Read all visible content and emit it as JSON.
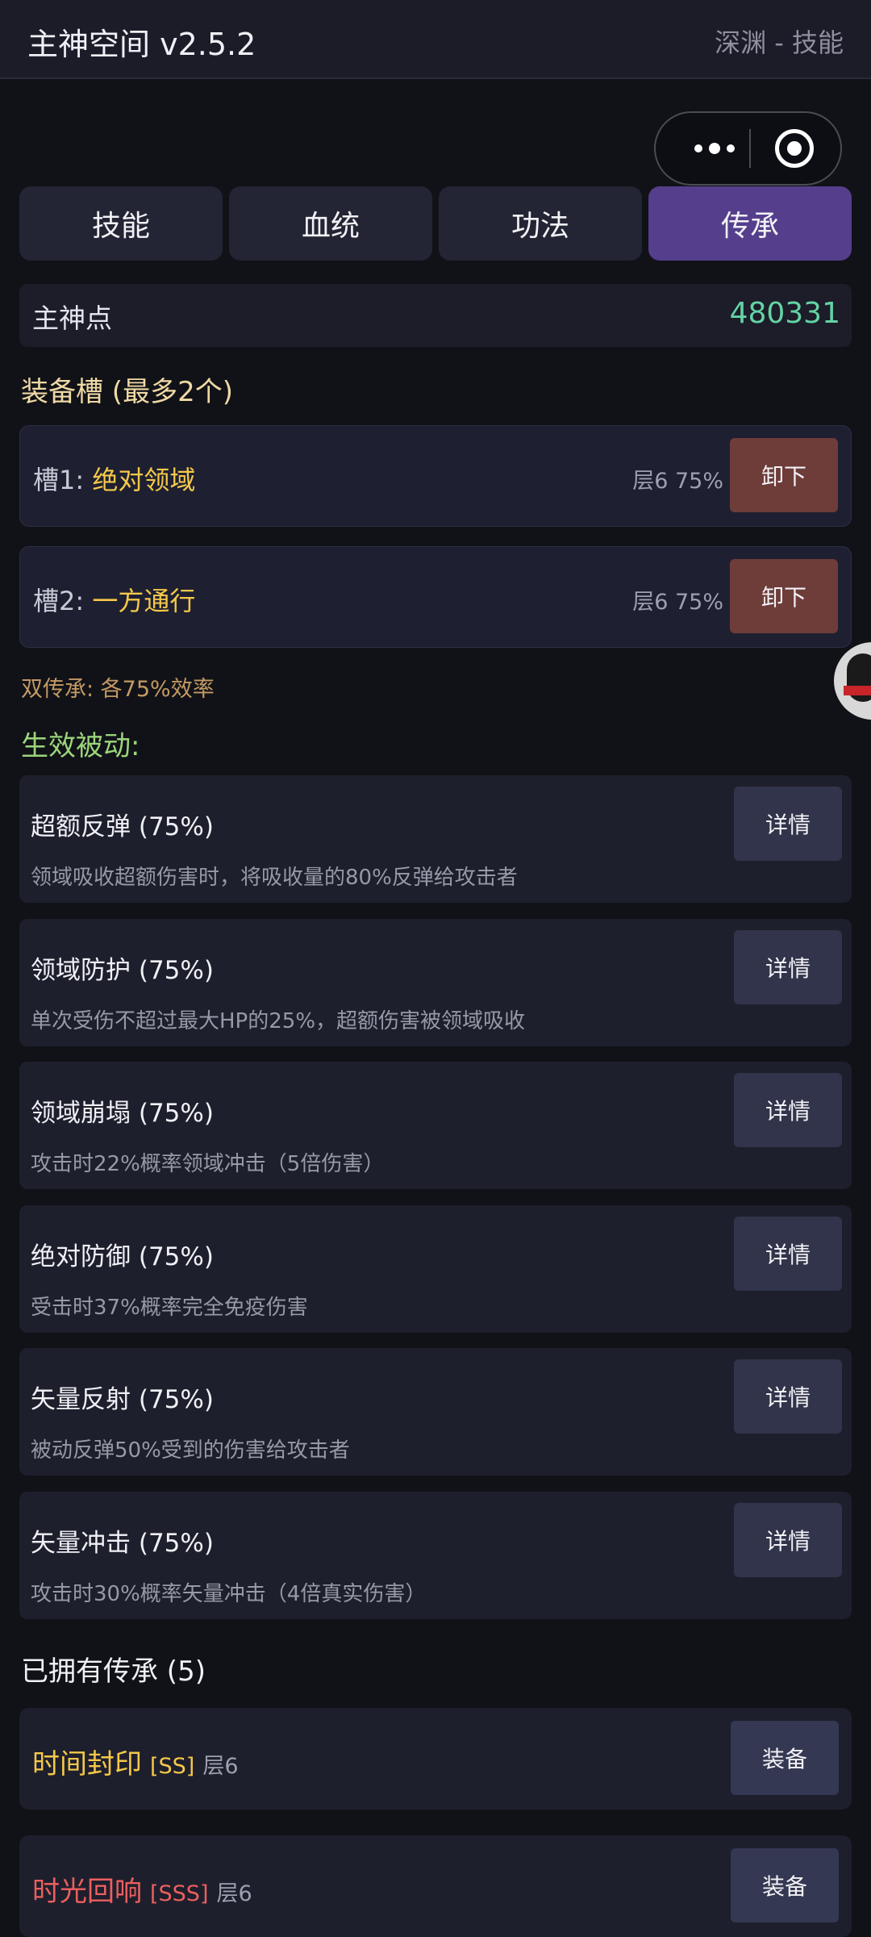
{
  "header": {
    "title": "主神空间 v2.5.2",
    "subtitle": "深渊 - 技能"
  },
  "tabs": [
    {
      "label": "技能",
      "active": false
    },
    {
      "label": "血统",
      "active": false
    },
    {
      "label": "功法",
      "active": false
    },
    {
      "label": "传承",
      "active": true
    }
  ],
  "points": {
    "label": "主神点",
    "value": "480331"
  },
  "equip": {
    "title": "装备槽 (最多2个)",
    "slots": [
      {
        "prefix": "槽1: ",
        "name": "绝对领域",
        "meta": "层6 75%",
        "button": "卸下"
      },
      {
        "prefix": "槽2: ",
        "name": "一方通行",
        "meta": "层6 75%",
        "button": "卸下"
      }
    ],
    "note": "双传承: 各75%效率"
  },
  "passives": {
    "title": "生效被动:",
    "items": [
      {
        "name": "超额反弹 (75%)",
        "desc": "领域吸收超额伤害时，将吸收量的80%反弹给攻击者",
        "button": "详情"
      },
      {
        "name": "领域防护 (75%)",
        "desc": "单次受伤不超过最大HP的25%，超额伤害被领域吸收",
        "button": "详情"
      },
      {
        "name": "领域崩塌 (75%)",
        "desc": "攻击时22%概率领域冲击（5倍伤害）",
        "button": "详情"
      },
      {
        "name": "绝对防御 (75%)",
        "desc": "受击时37%概率完全免疫伤害",
        "button": "详情"
      },
      {
        "name": "矢量反射 (75%)",
        "desc": "被动反弹50%受到的伤害给攻击者",
        "button": "详情"
      },
      {
        "name": "矢量冲击 (75%)",
        "desc": "攻击时30%概率矢量冲击（4倍真实伤害）",
        "button": "详情"
      }
    ]
  },
  "owned": {
    "title": "已拥有传承 (5)",
    "items": [
      {
        "name": "时间封印",
        "grade": "[SS]",
        "layer": "层6",
        "button": "装备",
        "color": "#f5c84a"
      },
      {
        "name": "时光回响",
        "grade": "[SSS]",
        "layer": "层6",
        "button": "装备",
        "color": "#ec5f5f"
      }
    ]
  },
  "colors": {
    "accent_tab": "#553f8c",
    "points": "#64d3a6",
    "unequip": "#6e3c39",
    "equip": "#343852"
  }
}
